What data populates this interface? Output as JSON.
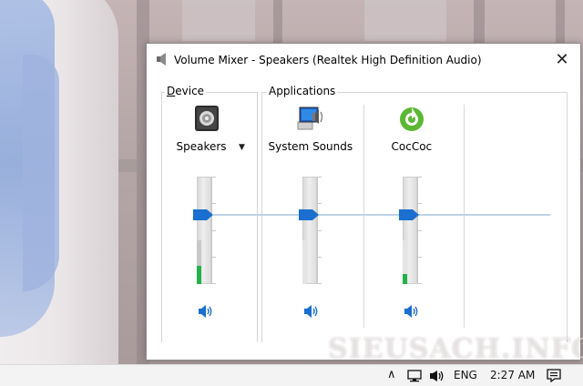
{
  "window": {
    "title": "Volume Mixer - Speakers (Realtek High Definition Audio)",
    "close_glyph": "✕"
  },
  "groups": {
    "device_first_letter": "D",
    "device_rest": "evice",
    "applications_label": "Applications"
  },
  "channels": [
    {
      "label": "Speakers",
      "icon": "speaker-device-icon",
      "volume_percent": 68,
      "peak_percent": 42,
      "has_dropdown": true,
      "dropdown_glyph": "▼"
    },
    {
      "label": "System Sounds",
      "icon": "system-sounds-icon",
      "volume_percent": 68,
      "peak_percent": 0
    },
    {
      "label": "CocCoc",
      "icon": "coccoc-browser-icon",
      "volume_percent": 68,
      "peak_percent": 22
    }
  ],
  "taskbar": {
    "chevron": "∧",
    "language": "ENG",
    "time": "2:27 AM"
  },
  "watermark": "SIEUSACH.INFO",
  "colors": {
    "accent": "#1a6fd0",
    "peak_green": "#21b24a",
    "coccoc_green": "#5bb833"
  }
}
